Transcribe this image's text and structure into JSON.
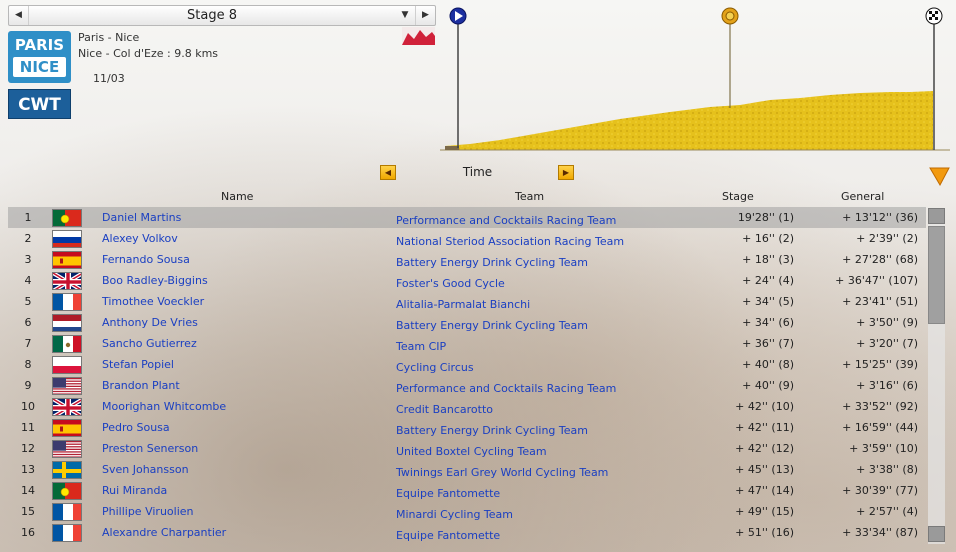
{
  "stage_selector": {
    "label": "Stage 8",
    "prev_glyph": "◀",
    "next_glyph": "▶",
    "dropdown_glyph": "▼"
  },
  "race": {
    "logo_line1": "PARIS",
    "logo_line2": "NICE",
    "category": "CWT",
    "name": "Paris - Nice",
    "route": "Nice - Col d'Eze : 9.8 kms",
    "date": "11/03"
  },
  "sort": {
    "label": "Time",
    "prev_glyph": "◀",
    "next_glyph": "▶"
  },
  "columns": {
    "name": "Name",
    "team": "Team",
    "stage": "Stage",
    "general": "General"
  },
  "colors": {
    "link": "#1a3fc2",
    "profile_fill": "#e8c21a",
    "accent": "#f0a800"
  },
  "rows": [
    {
      "rank": "1",
      "flag": "portugal",
      "name": "Daniel Martins",
      "team": "Performance and Cocktails Racing Team",
      "stage": "19'28'' (1)",
      "general": "+ 13'12'' (36)"
    },
    {
      "rank": "2",
      "flag": "russia",
      "name": "Alexey Volkov",
      "team": "National Steriod Association Racing Team",
      "stage": "+ 16'' (2)",
      "general": "+ 2'39'' (2)"
    },
    {
      "rank": "3",
      "flag": "spain",
      "name": "Fernando Sousa",
      "team": "Battery Energy Drink Cycling Team",
      "stage": "+ 18'' (3)",
      "general": "+ 27'28'' (68)"
    },
    {
      "rank": "4",
      "flag": "uk",
      "name": "Boo Radley-Biggins",
      "team": "Foster's Good Cycle",
      "stage": "+ 24'' (4)",
      "general": "+ 36'47'' (107)"
    },
    {
      "rank": "5",
      "flag": "france",
      "name": "Timothee Voeckler",
      "team": "Alitalia-Parmalat Bianchi",
      "stage": "+ 34'' (5)",
      "general": "+ 23'41'' (51)"
    },
    {
      "rank": "6",
      "flag": "netherlands",
      "name": "Anthony De Vries",
      "team": "Battery Energy Drink Cycling Team",
      "stage": "+ 34'' (6)",
      "general": "+ 3'50'' (9)"
    },
    {
      "rank": "7",
      "flag": "mexico",
      "name": "Sancho Gutierrez",
      "team": "Team CIP",
      "stage": "+ 36'' (7)",
      "general": "+ 3'20'' (7)"
    },
    {
      "rank": "8",
      "flag": "poland",
      "name": "Stefan Popiel",
      "team": "Cycling Circus",
      "stage": "+ 40'' (8)",
      "general": "+ 15'25'' (39)"
    },
    {
      "rank": "9",
      "flag": "usa",
      "name": "Brandon Plant",
      "team": "Performance and Cocktails Racing Team",
      "stage": "+ 40'' (9)",
      "general": "+ 3'16'' (6)"
    },
    {
      "rank": "10",
      "flag": "uk",
      "name": "Moorighan Whitcombe",
      "team": "Credit Bancarotto",
      "stage": "+ 42'' (10)",
      "general": "+ 33'52'' (92)"
    },
    {
      "rank": "11",
      "flag": "spain",
      "name": "Pedro Sousa",
      "team": "Battery Energy Drink Cycling Team",
      "stage": "+ 42'' (11)",
      "general": "+ 16'59'' (44)"
    },
    {
      "rank": "12",
      "flag": "usa",
      "name": "Preston Senerson",
      "team": "United Boxtel Cycling Team",
      "stage": "+ 42'' (12)",
      "general": "+ 3'59'' (10)"
    },
    {
      "rank": "13",
      "flag": "sweden",
      "name": "Sven Johansson",
      "team": "Twinings Earl Grey World Cycling Team",
      "stage": "+ 45'' (13)",
      "general": "+ 3'38'' (8)"
    },
    {
      "rank": "14",
      "flag": "portugal",
      "name": "Rui Miranda",
      "team": "Equipe Fantomette",
      "stage": "+ 47'' (14)",
      "general": "+ 30'39'' (77)"
    },
    {
      "rank": "15",
      "flag": "france",
      "name": "Phillipe Viruolien",
      "team": "Minardi Cycling Team",
      "stage": "+ 49'' (15)",
      "general": "+ 2'57'' (4)"
    },
    {
      "rank": "16",
      "flag": "france",
      "name": "Alexandre Charpantier",
      "team": "Equipe Fantomette",
      "stage": "+ 51'' (16)",
      "general": "+ 33'34'' (87)"
    }
  ]
}
